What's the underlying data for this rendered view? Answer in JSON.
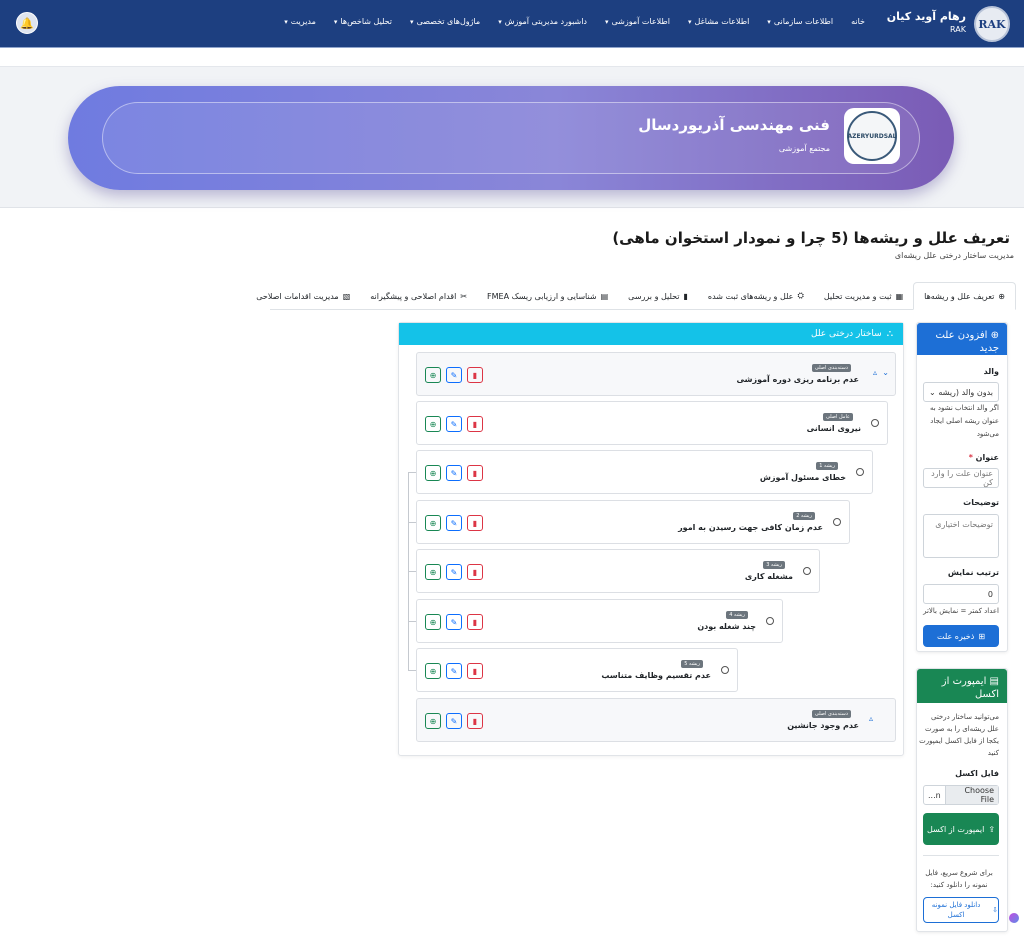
{
  "header": {
    "logo_text": "RAK",
    "brand_title": "رهام آوید کیان",
    "brand_sub": "RAK",
    "nav": [
      {
        "label": "خانه",
        "caret": false
      },
      {
        "label": "اطلاعات سازمانی",
        "caret": true
      },
      {
        "label": "اطلاعات مشاغل",
        "caret": true
      },
      {
        "label": "اطلاعات آموزشی",
        "caret": true
      },
      {
        "label": "داشبورد مدیریتی آموزش",
        "caret": true
      },
      {
        "label": "ماژول‌های تخصصی",
        "caret": true
      },
      {
        "label": "تحلیل شاخص‌ها",
        "caret": true
      },
      {
        "label": "مدیریت",
        "caret": true
      }
    ]
  },
  "hero": {
    "logo_text": "AZERYURDSAL",
    "title": "فنی مهندسی آذریوردسال",
    "subtitle": "مجتمع آموزشی"
  },
  "page": {
    "title": "تعریف علل و ریشه‌ها (5 چرا و نمودار استخوان ماهی)",
    "subtitle": "مدیریت ساختار درختی علل ریشه‌ای"
  },
  "tabs": [
    {
      "label": "تعریف علل و ریشه‌ها",
      "icon": "⊕",
      "active": true
    },
    {
      "label": "ثبت و مدیریت تحلیل",
      "icon": "▦",
      "active": false
    },
    {
      "label": "علل و ریشه‌های ثبت شده",
      "icon": "⛭",
      "active": false
    },
    {
      "label": "تحلیل و بررسی",
      "icon": "▮",
      "active": false
    },
    {
      "label": "شناسایی و ارزیابی ریسک FMEA",
      "icon": "▤",
      "active": false
    },
    {
      "label": "اقدام اصلاحی و پیشگیرانه",
      "icon": "✂",
      "active": false
    },
    {
      "label": "مدیریت اقدامات اصلاحی",
      "icon": "▧",
      "active": false
    }
  ],
  "add_form": {
    "header": "افزودن علت جدید",
    "parent_label": "والد",
    "parent_value": "بدون والد (ریشه",
    "parent_hint": "اگر والد انتخاب نشود به عنوان ریشه اصلی ایجاد می‌شود",
    "title_label": "عنوان",
    "title_required": "*",
    "title_placeholder": "عنوان علت را وارد کن",
    "desc_label": "توضیحات",
    "desc_placeholder": "توضیحات اختیاری",
    "order_label": "ترتیب نمایش",
    "order_value": "0",
    "order_hint": "اعداد کمتر = نمایش بالاتر",
    "save_label": "ذخیره علت"
  },
  "import_form": {
    "header": "ایمپورت از اکسل",
    "desc": "می‌توانید ساختار درختی علل ریشه‌ای را به صورت یکجا از فایل اکسل ایمپورت کنید",
    "file_label": "فایل اکسل",
    "choose_label": "Choose File",
    "no_file": "n...",
    "import_label": "ایمپورت از اکسل",
    "sample_desc": "برای شروع سریع، فایل نمونه را دانلود کنید:",
    "download_label": "دانلود فایل نمونه اکسل"
  },
  "tree": {
    "header": "ساختار درختی علل",
    "nodes": [
      {
        "title": "عدم برنامه ریزی دوره آموزشی",
        "badge": "دسته‌بندی اصلی",
        "kind": "root-open"
      },
      {
        "title": "نیروی انسانی",
        "badge": "عامل اصلی",
        "kind": "radio"
      },
      {
        "title": "خطای مسئول آموزش",
        "badge": "ریشه 1",
        "kind": "radio"
      },
      {
        "title": "عدم زمان کافی جهت رسیدن به امور",
        "badge": "ریشه 2",
        "kind": "radio"
      },
      {
        "title": "مشغله کاری",
        "badge": "ریشه 3",
        "kind": "radio"
      },
      {
        "title": "چند شغله بودن",
        "badge": "ریشه 4",
        "kind": "radio"
      },
      {
        "title": "عدم تقسیم وظایف متناسب",
        "badge": "ریشه 5",
        "kind": "radio"
      },
      {
        "title": "عدم وجود جانشین",
        "badge": "دسته‌بندی اصلی",
        "kind": "root"
      }
    ]
  }
}
